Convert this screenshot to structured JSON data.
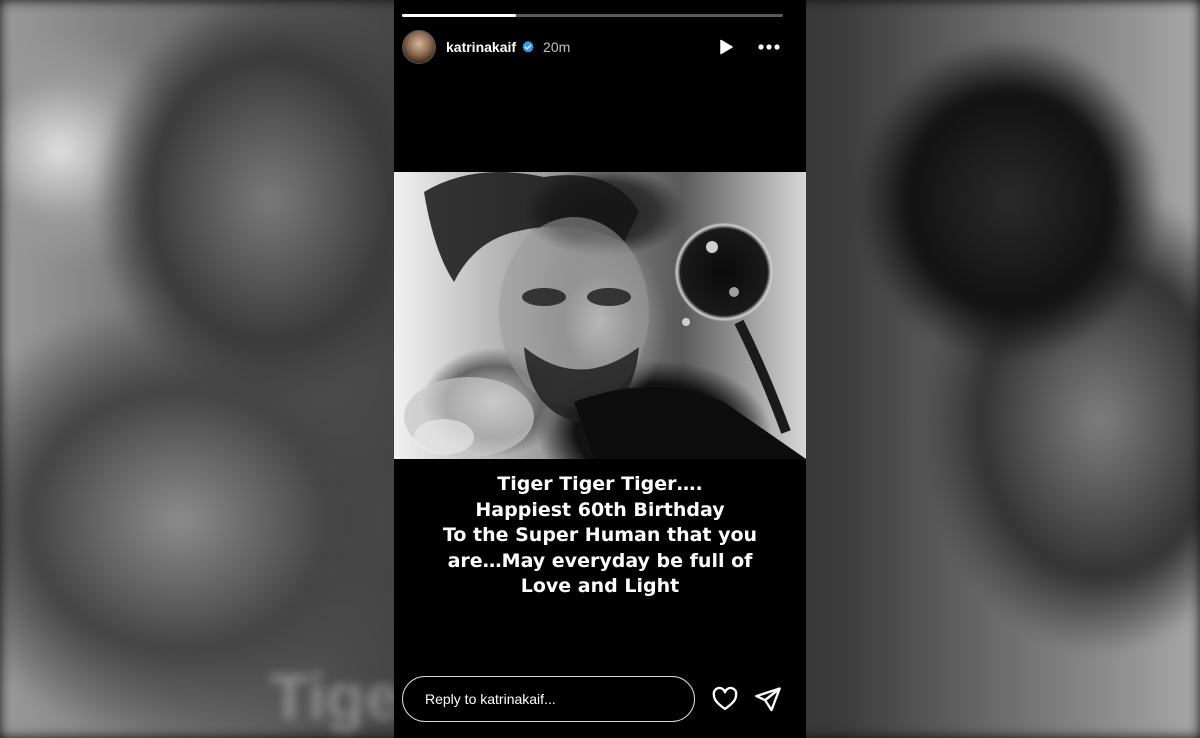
{
  "background_text": "Tiger",
  "story": {
    "progress_fraction": 0.3,
    "username": "katrinakaif",
    "time": "20m",
    "icons": {
      "verified": "verified-badge-icon",
      "play": "play-icon",
      "more": "more-options-icon",
      "like": "heart-icon",
      "share": "send-icon"
    },
    "caption_lines": [
      "Tiger Tiger Tiger….",
      "Happiest 60th Birthday",
      "To the Super Human that you",
      "are…May everyday be full of",
      "Love and Light"
    ],
    "reply_placeholder": "Reply to katrinakaif..."
  }
}
